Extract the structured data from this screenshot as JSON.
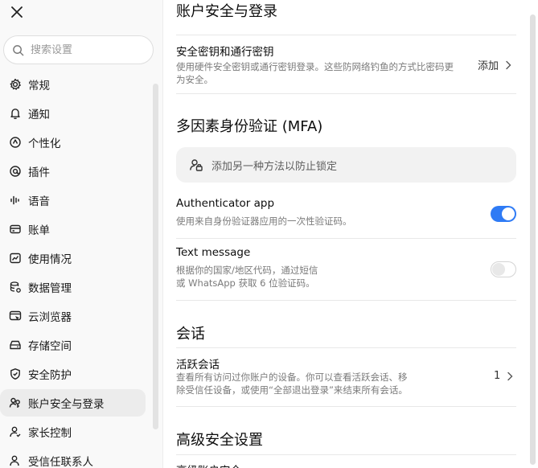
{
  "sidebar": {
    "search_placeholder": "搜索设置",
    "items": [
      {
        "label": "常规",
        "icon": "gear-icon"
      },
      {
        "label": "通知",
        "icon": "bell-icon"
      },
      {
        "label": "个性化",
        "icon": "personalize-icon"
      },
      {
        "label": "插件",
        "icon": "plugin-icon"
      },
      {
        "label": "语音",
        "icon": "voice-icon"
      },
      {
        "label": "账单",
        "icon": "card-icon"
      },
      {
        "label": "使用情况",
        "icon": "chart-icon"
      },
      {
        "label": "数据管理",
        "icon": "data-icon"
      },
      {
        "label": "云浏览器",
        "icon": "cloud-browser-icon"
      },
      {
        "label": "存储空间",
        "icon": "storage-icon"
      },
      {
        "label": "安全防护",
        "icon": "shield-icon"
      },
      {
        "label": "账户安全与登录",
        "icon": "users-icon"
      },
      {
        "label": "家长控制",
        "icon": "person-icon"
      },
      {
        "label": "受信任联系人",
        "icon": "contact-icon"
      }
    ],
    "active_index": 11
  },
  "main": {
    "page_title": "账户安全与登录",
    "passkey": {
      "title": "安全密钥和通行密钥",
      "desc1": "使用硬件安全密钥或通行密钥登录。这些防网络钓鱼的方式比密码更",
      "desc2": "为安全。",
      "action": "添加"
    },
    "mfa": {
      "title": "多因素身份验证 (MFA)",
      "box_text": "添加另一种方法以防止锁定",
      "auth_app": {
        "title": "Authenticator app",
        "desc": "使用来自身份验证器应用的一次性验证码。",
        "enabled": true
      },
      "text_message": {
        "title": "Text message",
        "desc1": "根据你的国家/地区代码，通过短信",
        "desc2": "或 WhatsApp 获取 6 位验证码。",
        "enabled": false
      }
    },
    "sessions": {
      "title": "会话",
      "active": {
        "title": "活跃会话",
        "desc1": "查看所有访问过你账户的设备。你可以查看活跃会话、移",
        "desc2": "除受信任设备，或使用“全部退出登录”来结束所有会话。",
        "count": "1"
      }
    },
    "advanced": {
      "title": "高级安全设置",
      "row_title": "高级账户安全"
    }
  },
  "colors": {
    "accent": "#2f7bf5",
    "sidebar_bg": "#f9f9f9",
    "active_bg": "#ececec"
  }
}
